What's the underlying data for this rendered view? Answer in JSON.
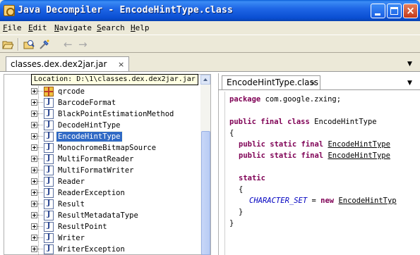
{
  "window": {
    "title": "Java Decompiler - EncodeHintType.class",
    "controls": {
      "minimize": "minimize",
      "maximize": "maximize",
      "close": "×"
    }
  },
  "menubar": {
    "items": [
      {
        "label": "File",
        "mnemonic": "F",
        "rest": "ile"
      },
      {
        "label": "Edit",
        "mnemonic": "E",
        "rest": "dit"
      },
      {
        "label": "Navigate",
        "mnemonic": "N",
        "rest": "avigate"
      },
      {
        "label": "Search",
        "mnemonic": "S",
        "rest": "earch"
      },
      {
        "label": "Help",
        "mnemonic": "H",
        "rest": "elp"
      }
    ]
  },
  "toolbar": {
    "icons": [
      "open-file-icon",
      "open-type-icon",
      "back-icon",
      "forward-icon"
    ],
    "back_glyph": "←",
    "forward_glyph": "→"
  },
  "outer_tab": {
    "label": "classes.dex.dex2jar.jar",
    "close_glyph": "×"
  },
  "dropdown_glyph": "▼",
  "tooltip": "Location: D:\\1\\classes.dex.dex2jar.jar",
  "tree": {
    "items": [
      {
        "label": "qrcode",
        "type": "package"
      },
      {
        "label": "BarcodeFormat",
        "type": "class"
      },
      {
        "label": "BlackPointEstimationMethod",
        "type": "class"
      },
      {
        "label": "DecodeHintType",
        "type": "class"
      },
      {
        "label": "EncodeHintType",
        "type": "class",
        "selected": true
      },
      {
        "label": "MonochromeBitmapSource",
        "type": "class"
      },
      {
        "label": "MultiFormatReader",
        "type": "class"
      },
      {
        "label": "MultiFormatWriter",
        "type": "class"
      },
      {
        "label": "Reader",
        "type": "class"
      },
      {
        "label": "ReaderException",
        "type": "class"
      },
      {
        "label": "Result",
        "type": "class"
      },
      {
        "label": "ResultMetadataType",
        "type": "class"
      },
      {
        "label": "ResultPoint",
        "type": "class"
      },
      {
        "label": "Writer",
        "type": "class"
      },
      {
        "label": "WriterException",
        "type": "class"
      }
    ]
  },
  "editor": {
    "tab_label": "EncodeHintType.class",
    "tab_close_glyph": "×",
    "code": {
      "l1_kw": "package",
      "l1_rest": " com.google.zxing;",
      "l2_kw": "public final class",
      "l2_rest": " EncodeHintType",
      "l3": "{",
      "l4_kw": "public static final",
      "l4_type": "EncodeHintType",
      "l5_kw": "public static final",
      "l5_type": "EncodeHintType",
      "l6_kw": "static",
      "l7": "{",
      "l8_field": "CHARACTER_SET",
      "l8_eq": " = ",
      "l8_new": "new",
      "l8_type": "EncodeHintTyp",
      "l9": "}",
      "l10": "}"
    }
  }
}
